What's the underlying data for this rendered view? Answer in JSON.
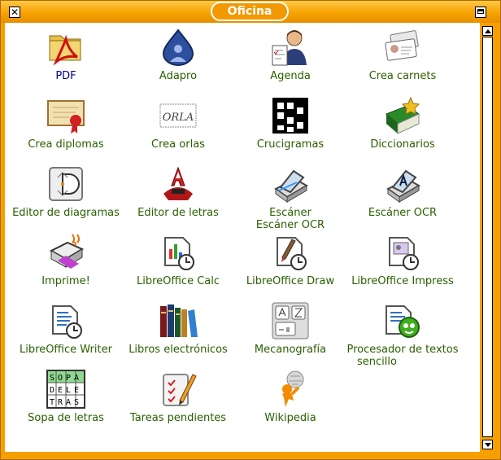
{
  "window": {
    "title": "Oficina"
  },
  "items": [
    {
      "label": "PDF",
      "icon": "pdf-folder-icon"
    },
    {
      "label": "Adapro",
      "icon": "adapro-drop-icon"
    },
    {
      "label": "Agenda",
      "icon": "agenda-person-icon"
    },
    {
      "label": "Crea carnets",
      "icon": "id-card-icon"
    },
    {
      "label": "Crea diplomas",
      "icon": "diploma-icon"
    },
    {
      "label": "Crea orlas",
      "icon": "orla-icon"
    },
    {
      "label": "Crucigramas",
      "icon": "crossword-icon"
    },
    {
      "label": "Diccionarios",
      "icon": "dictionary-book-icon"
    },
    {
      "label": "Editor de diagramas",
      "icon": "diagram-editor-icon"
    },
    {
      "label": "Editor de letras",
      "icon": "font-editor-icon"
    },
    {
      "label": "Escáner",
      "label2": "Escáner OCR",
      "icon": "scanner-icon"
    },
    {
      "label": "Escáner OCR",
      "icon": "scanner-ocr-icon"
    },
    {
      "label": "Imprime!",
      "icon": "printer-icon"
    },
    {
      "label": "LibreOffice Calc",
      "icon": "libreoffice-calc-icon"
    },
    {
      "label": "LibreOffice Draw",
      "icon": "libreoffice-draw-icon"
    },
    {
      "label": "LibreOffice Impress",
      "icon": "libreoffice-impress-icon"
    },
    {
      "label": "LibreOffice Writer",
      "icon": "libreoffice-writer-icon"
    },
    {
      "label": "Libros electrónicos",
      "icon": "books-icon"
    },
    {
      "label": "Mecanografía",
      "icon": "keyboard-keys-icon"
    },
    {
      "label": "Procesador de textos",
      "label2": "sencillo",
      "icon": "text-processor-icon"
    },
    {
      "label": "Sopa de letras",
      "icon": "word-search-icon"
    },
    {
      "label": "Tareas pendientes",
      "icon": "task-list-icon"
    },
    {
      "label": "Wikipedia",
      "icon": "wikipedia-icon"
    }
  ],
  "icon_text": {
    "orla": "ORLA",
    "sopa_row1": "SOPA",
    "sopa_row2": "DELE",
    "sopa_row3": "TRAS"
  }
}
